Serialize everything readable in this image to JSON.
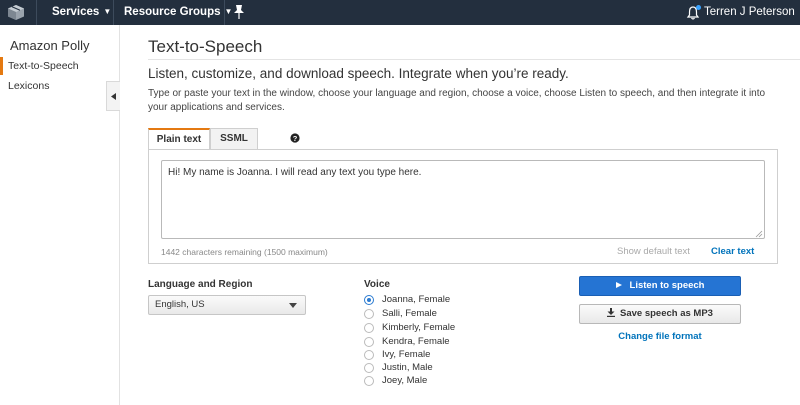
{
  "topbar": {
    "services_label": "Services",
    "resource_groups_label": "Resource Groups",
    "user_name": "Terren J Peterson"
  },
  "sidebar": {
    "title": "Amazon Polly",
    "items": [
      {
        "label": "Text-to-Speech",
        "active": true
      },
      {
        "label": "Lexicons",
        "active": false
      }
    ]
  },
  "main": {
    "title": "Text-to-Speech",
    "subtitle": "Listen, customize, and download speech. Integrate when you’re ready.",
    "description": "Type or paste your text in the window, choose your language and region, choose a voice, choose Listen to speech, and then integrate it into your applications and services.",
    "tabs": [
      {
        "label": "Plain text",
        "active": true
      },
      {
        "label": "SSML",
        "active": false
      }
    ],
    "text_input": {
      "value": "Hi! My name is Joanna. I will read any text you type here."
    },
    "chars_remaining": "1442 characters remaining (1500 maximum)",
    "show_default_label": "Show default text",
    "clear_text_label": "Clear text",
    "language": {
      "label": "Language and Region",
      "selected": "English, US"
    },
    "voice": {
      "label": "Voice",
      "options": [
        {
          "label": "Joanna, Female",
          "checked": true
        },
        {
          "label": "Salli, Female",
          "checked": false
        },
        {
          "label": "Kimberly, Female",
          "checked": false
        },
        {
          "label": "Kendra, Female",
          "checked": false
        },
        {
          "label": "Ivy, Female",
          "checked": false
        },
        {
          "label": "Justin, Male",
          "checked": false
        },
        {
          "label": "Joey, Male",
          "checked": false
        }
      ]
    },
    "listen_button_label": "Listen to speech",
    "save_button_label": "Save speech as MP3",
    "change_format_label": "Change file format"
  },
  "colors": {
    "nav_bg": "#232f3e",
    "accent_orange": "#e47911",
    "primary_blue": "#2574d3",
    "link_blue": "#0073bb"
  }
}
